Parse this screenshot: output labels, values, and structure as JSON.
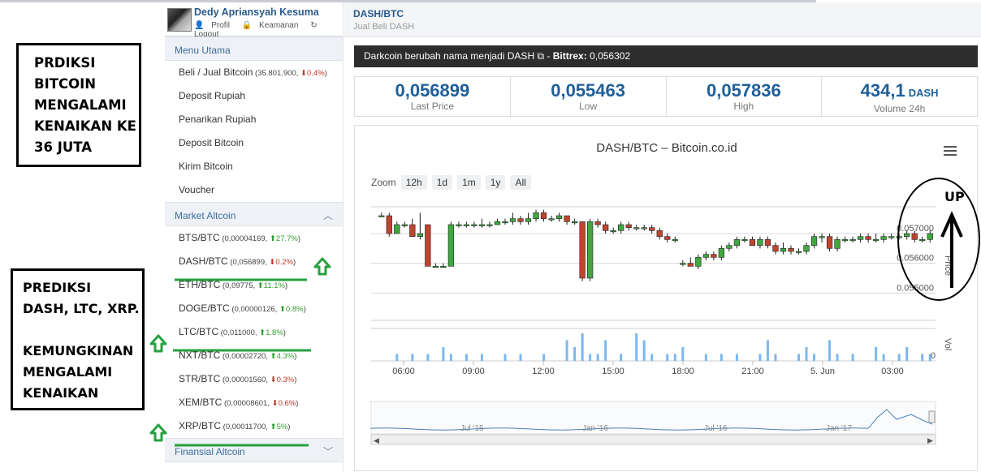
{
  "annotations": {
    "box1": [
      "PRDIKSI",
      "BITCOIN",
      "MENGALAMI",
      "KENAIKAN KE",
      "36 JUTA"
    ],
    "box2a": [
      "PREDIKSI",
      "DASH, LTC, XRP."
    ],
    "box2b": [
      "KEMUNGKINAN",
      "MENGALAMI",
      "KENAIKAN"
    ],
    "up_label": "UP"
  },
  "user": {
    "name": "Dedy Apriansyah Kesuma",
    "profile": "Profil",
    "security": "Keamanan",
    "logout": "Logout"
  },
  "menu": {
    "title": "Menu Utama",
    "items": [
      {
        "label": "Beli / Jual Bitcoin",
        "sub": "(35.801.900,",
        "change": "0.4%",
        "dir": "down"
      },
      {
        "label": "Deposit Rupiah"
      },
      {
        "label": "Penarikan Rupiah"
      },
      {
        "label": "Deposit Bitcoin"
      },
      {
        "label": "Kirim Bitcoin"
      },
      {
        "label": "Voucher"
      }
    ]
  },
  "market": {
    "title": "Market Altcoin",
    "items": [
      {
        "label": "BTS/BTC",
        "sub": "(0,00004169,",
        "change": "27.7%",
        "dir": "up"
      },
      {
        "label": "DASH/BTC",
        "sub": "(0,056899,",
        "change": "0.2%",
        "dir": "down"
      },
      {
        "label": "ETH/BTC",
        "sub": "(0,09775,",
        "change": "11.1%",
        "dir": "up"
      },
      {
        "label": "DOGE/BTC",
        "sub": "(0,00000126,",
        "change": "0.8%",
        "dir": "up"
      },
      {
        "label": "LTC/BTC",
        "sub": "(0,011000,",
        "change": "1.8%",
        "dir": "up"
      },
      {
        "label": "NXT/BTC",
        "sub": "(0,00002720,",
        "change": "4.3%",
        "dir": "up"
      },
      {
        "label": "STR/BTC",
        "sub": "(0,00001560,",
        "change": "0.3%",
        "dir": "down"
      },
      {
        "label": "XEM/BTC",
        "sub": "(0,00008601,",
        "change": "0.6%",
        "dir": "down"
      },
      {
        "label": "XRP/BTC",
        "sub": "(0,00011700,",
        "change": "5%",
        "dir": "up"
      }
    ]
  },
  "financial": {
    "title": "Finansial Altcoin"
  },
  "header": {
    "pair": "DASH/BTC",
    "subtitle": "Jual Beli DASH"
  },
  "notice": {
    "text": "Darkcoin berubah nama menjadi DASH",
    "sep": "-",
    "bittrex_label": "Bittrex:",
    "bittrex_value": "0,056302"
  },
  "stats": [
    {
      "value": "0,056899",
      "label": "Last Price"
    },
    {
      "value": "0,055463",
      "label": "Low"
    },
    {
      "value": "0,057836",
      "label": "High"
    },
    {
      "value": "434,1",
      "unit": "DASH",
      "label": "Volume 24h"
    }
  ],
  "chart_title": "DASH/BTC – Bitcoin.co.id",
  "zoom": {
    "label": "Zoom",
    "options": [
      "12h",
      "1d",
      "1m",
      "1y",
      "All"
    ]
  },
  "chart_data": {
    "type": "candlestick",
    "title": "DASH/BTC – Bitcoin.co.id",
    "ylabel": "Price",
    "ytick_labels": [
      "0.057000",
      "0.056000",
      "0.055000"
    ],
    "yticks": [
      0.057,
      0.056,
      0.055
    ],
    "ylim": [
      0.0549,
      0.0579
    ],
    "vol_label": "Vol",
    "vol_tick": "0",
    "xtick_labels": [
      "06:00",
      "09:00",
      "12:00",
      "15:00",
      "18:00",
      "21:00",
      "5. Jun",
      "03:00"
    ],
    "navigator_labels": [
      "Jul '15",
      "Jan '16",
      "Jul '16",
      "Jan '17"
    ],
    "candles": [
      {
        "o": 0.0576,
        "c": 0.0576,
        "h": 0.0577,
        "l": 0.0576
      },
      {
        "o": 0.0576,
        "c": 0.057,
        "h": 0.0577,
        "l": 0.0569
      },
      {
        "o": 0.057,
        "c": 0.0573,
        "h": 0.0574,
        "l": 0.057
      },
      {
        "o": 0.0573,
        "c": 0.0573,
        "h": 0.0574,
        "l": 0.0572
      },
      {
        "o": 0.0573,
        "c": 0.0569,
        "h": 0.0575,
        "l": 0.0569
      },
      {
        "o": 0.0569,
        "c": 0.057,
        "h": 0.0577,
        "l": 0.0568
      },
      {
        "o": 0.0573,
        "c": 0.0559,
        "h": 0.0573,
        "l": 0.0559
      },
      {
        "o": 0.0559,
        "c": 0.0559,
        "h": 0.056,
        "l": 0.0559
      },
      {
        "o": 0.0559,
        "c": 0.0559,
        "h": 0.056,
        "l": 0.0559
      },
      {
        "o": 0.0559,
        "c": 0.0573,
        "h": 0.0574,
        "l": 0.0559
      },
      {
        "o": 0.0573,
        "c": 0.0573,
        "h": 0.0574,
        "l": 0.0572
      },
      {
        "o": 0.0573,
        "c": 0.0573,
        "h": 0.0574,
        "l": 0.0572
      },
      {
        "o": 0.0573,
        "c": 0.0573,
        "h": 0.0574,
        "l": 0.0572
      },
      {
        "o": 0.0573,
        "c": 0.0573,
        "h": 0.0575,
        "l": 0.0572
      },
      {
        "o": 0.0573,
        "c": 0.0573,
        "h": 0.0574,
        "l": 0.0572
      },
      {
        "o": 0.0573,
        "c": 0.0574,
        "h": 0.0575,
        "l": 0.0573
      },
      {
        "o": 0.0574,
        "c": 0.0574,
        "h": 0.0575,
        "l": 0.0573
      },
      {
        "o": 0.0574,
        "c": 0.0575,
        "h": 0.0577,
        "l": 0.0573
      },
      {
        "o": 0.0575,
        "c": 0.0574,
        "h": 0.0576,
        "l": 0.0573
      },
      {
        "o": 0.0574,
        "c": 0.0575,
        "h": 0.0577,
        "l": 0.0573
      },
      {
        "o": 0.0575,
        "c": 0.0577,
        "h": 0.0578,
        "l": 0.0574
      },
      {
        "o": 0.0577,
        "c": 0.0575,
        "h": 0.0578,
        "l": 0.0574
      },
      {
        "o": 0.0575,
        "c": 0.0575,
        "h": 0.0576,
        "l": 0.0574
      },
      {
        "o": 0.0575,
        "c": 0.0576,
        "h": 0.0577,
        "l": 0.0574
      },
      {
        "o": 0.0576,
        "c": 0.0574,
        "h": 0.0576,
        "l": 0.0573
      },
      {
        "o": 0.0574,
        "c": 0.0574,
        "h": 0.0575,
        "l": 0.0573
      },
      {
        "o": 0.0574,
        "c": 0.0555,
        "h": 0.0574,
        "l": 0.0554
      },
      {
        "o": 0.0555,
        "c": 0.0574,
        "h": 0.0575,
        "l": 0.0554
      },
      {
        "o": 0.0574,
        "c": 0.0573,
        "h": 0.0575,
        "l": 0.0572
      },
      {
        "o": 0.0573,
        "c": 0.0571,
        "h": 0.0574,
        "l": 0.057
      },
      {
        "o": 0.0571,
        "c": 0.0571,
        "h": 0.0572,
        "l": 0.057
      },
      {
        "o": 0.0571,
        "c": 0.0573,
        "h": 0.0574,
        "l": 0.057
      },
      {
        "o": 0.0573,
        "c": 0.0572,
        "h": 0.0574,
        "l": 0.0571
      },
      {
        "o": 0.0572,
        "c": 0.0572,
        "h": 0.0573,
        "l": 0.0571
      },
      {
        "o": 0.0572,
        "c": 0.0572,
        "h": 0.0573,
        "l": 0.0571
      },
      {
        "o": 0.0572,
        "c": 0.0571,
        "h": 0.0573,
        "l": 0.057
      },
      {
        "o": 0.0571,
        "c": 0.0569,
        "h": 0.0572,
        "l": 0.0568
      },
      {
        "o": 0.0569,
        "c": 0.0568,
        "h": 0.057,
        "l": 0.0567
      },
      {
        "o": 0.0568,
        "c": 0.0568,
        "h": 0.0569,
        "l": 0.0567
      },
      {
        "o": 0.056,
        "c": 0.056,
        "h": 0.0561,
        "l": 0.0559
      },
      {
        "o": 0.056,
        "c": 0.0559,
        "h": 0.0562,
        "l": 0.0559
      },
      {
        "o": 0.0559,
        "c": 0.0562,
        "h": 0.0563,
        "l": 0.0558
      },
      {
        "o": 0.0562,
        "c": 0.0563,
        "h": 0.0564,
        "l": 0.0561
      },
      {
        "o": 0.0563,
        "c": 0.0562,
        "h": 0.0564,
        "l": 0.0561
      },
      {
        "o": 0.0562,
        "c": 0.0565,
        "h": 0.0566,
        "l": 0.0561
      },
      {
        "o": 0.0565,
        "c": 0.0566,
        "h": 0.0567,
        "l": 0.0564
      },
      {
        "o": 0.0566,
        "c": 0.0568,
        "h": 0.0569,
        "l": 0.0565
      },
      {
        "o": 0.0568,
        "c": 0.0568,
        "h": 0.0569,
        "l": 0.0567
      },
      {
        "o": 0.0568,
        "c": 0.0566,
        "h": 0.0569,
        "l": 0.0566
      },
      {
        "o": 0.0566,
        "c": 0.0568,
        "h": 0.0569,
        "l": 0.0565
      },
      {
        "o": 0.0568,
        "c": 0.0566,
        "h": 0.0569,
        "l": 0.0565
      },
      {
        "o": 0.0566,
        "c": 0.0564,
        "h": 0.0567,
        "l": 0.0563
      },
      {
        "o": 0.0564,
        "c": 0.0565,
        "h": 0.0567,
        "l": 0.0563
      },
      {
        "o": 0.0565,
        "c": 0.0564,
        "h": 0.0566,
        "l": 0.0563
      },
      {
        "o": 0.0564,
        "c": 0.0564,
        "h": 0.0565,
        "l": 0.0563
      },
      {
        "o": 0.0564,
        "c": 0.0566,
        "h": 0.0567,
        "l": 0.0563
      },
      {
        "o": 0.0566,
        "c": 0.0569,
        "h": 0.057,
        "l": 0.0565
      },
      {
        "o": 0.0569,
        "c": 0.0569,
        "h": 0.057,
        "l": 0.0567
      },
      {
        "o": 0.0569,
        "c": 0.0565,
        "h": 0.057,
        "l": 0.0564
      },
      {
        "o": 0.0565,
        "c": 0.0568,
        "h": 0.0569,
        "l": 0.0564
      },
      {
        "o": 0.0568,
        "c": 0.0568,
        "h": 0.0569,
        "l": 0.0567
      },
      {
        "o": 0.0568,
        "c": 0.0568,
        "h": 0.0569,
        "l": 0.0567
      },
      {
        "o": 0.0568,
        "c": 0.0569,
        "h": 0.057,
        "l": 0.0567
      },
      {
        "o": 0.0569,
        "c": 0.0568,
        "h": 0.057,
        "l": 0.0567
      },
      {
        "o": 0.0568,
        "c": 0.0568,
        "h": 0.057,
        "l": 0.0567
      },
      {
        "o": 0.0568,
        "c": 0.0569,
        "h": 0.057,
        "l": 0.0567
      },
      {
        "o": 0.0569,
        "c": 0.0569,
        "h": 0.057,
        "l": 0.0568
      },
      {
        "o": 0.0569,
        "c": 0.0569,
        "h": 0.057,
        "l": 0.0568
      },
      {
        "o": 0.0569,
        "c": 0.057,
        "h": 0.0571,
        "l": 0.0568
      },
      {
        "o": 0.057,
        "c": 0.0568,
        "h": 0.0571,
        "l": 0.0567
      },
      {
        "o": 0.0568,
        "c": 0.0568,
        "h": 0.0569,
        "l": 0.0567
      },
      {
        "o": 0.0568,
        "c": 0.057,
        "h": 0.0571,
        "l": 0.0567
      }
    ],
    "volume": [
      0,
      0,
      1,
      0,
      1,
      0,
      1,
      0,
      2,
      1,
      0,
      1,
      0,
      1,
      0,
      0,
      1,
      0,
      1,
      0,
      0,
      1,
      0,
      0,
      3,
      2,
      4,
      1,
      1,
      3,
      0,
      1,
      0,
      4,
      3,
      1,
      0,
      1,
      1,
      2,
      0,
      0,
      1,
      0,
      1,
      0,
      1,
      0,
      0,
      1,
      3,
      1,
      0,
      0,
      1,
      2,
      1,
      0,
      3,
      1,
      0,
      1,
      0,
      0,
      2,
      1,
      0,
      1,
      2,
      0,
      1,
      1
    ]
  },
  "colors": {
    "up": "#2e9e2e",
    "down": "#c0392b",
    "accent": "#1f5f99",
    "annotation_green": "#27a040"
  }
}
